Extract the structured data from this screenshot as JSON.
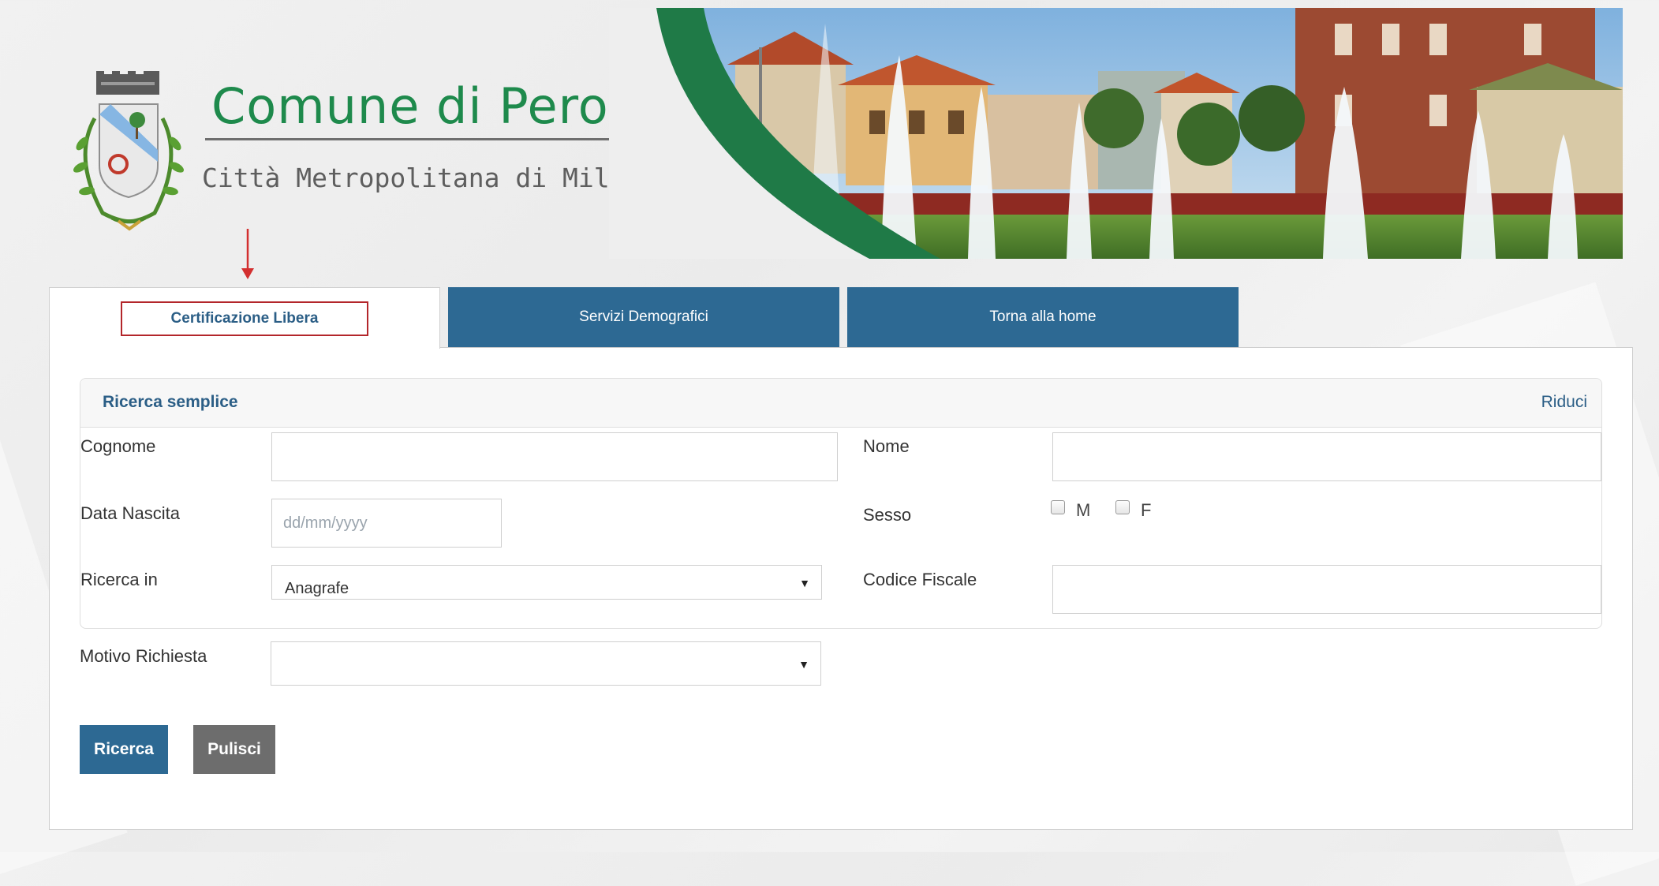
{
  "header": {
    "title": "Comune di Pero",
    "subtitle": "Città Metropolitana di Milano"
  },
  "tabs": [
    {
      "label": "Certificazione Libera",
      "active": true
    },
    {
      "label": "Servizi Demografici",
      "active": false
    },
    {
      "label": "Torna alla home",
      "active": false
    }
  ],
  "search_section": {
    "title": "Ricerca semplice",
    "toggle_label": "Riduci"
  },
  "form": {
    "cognome": {
      "label": "Cognome",
      "value": ""
    },
    "nome": {
      "label": "Nome",
      "value": ""
    },
    "data_nascita": {
      "label": "Data Nascita",
      "placeholder": "dd/mm/yyyy",
      "value": ""
    },
    "sesso": {
      "label": "Sesso",
      "option_m": "M",
      "option_f": "F"
    },
    "ricerca_in": {
      "label": "Ricerca in",
      "value": "Anagrafe"
    },
    "codice_fiscale": {
      "label": "Codice Fiscale",
      "value": ""
    },
    "motivo_richiesta": {
      "label": "Motivo Richiesta",
      "value": ""
    }
  },
  "actions": {
    "search_label": "Ricerca",
    "clear_label": "Pulisci"
  },
  "colors": {
    "brand_green": "#1e8a4c",
    "tab_blue": "#2d6993",
    "annotation_red": "#d32f2f",
    "button_gray": "#6d6d6d"
  },
  "icons": [
    "municipal-crest-icon",
    "down-arrow-annotation-icon",
    "dropdown-caret-icon"
  ]
}
